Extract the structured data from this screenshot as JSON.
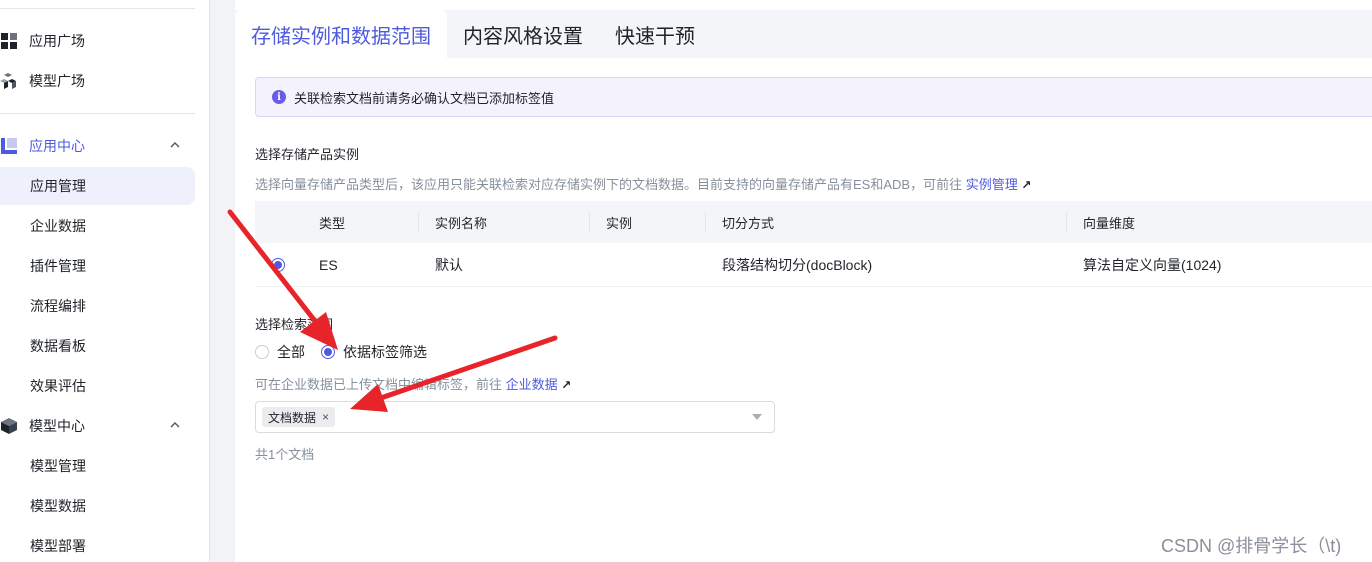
{
  "sidebar": {
    "items": [
      {
        "label": "应用广场",
        "icon": "grid-icon",
        "type": "top"
      },
      {
        "label": "模型广场",
        "icon": "cubes-icon",
        "type": "top"
      },
      {
        "label": "应用中心",
        "icon": "app-center-icon",
        "type": "group",
        "expanded": true
      },
      {
        "label": "应用管理",
        "type": "sub",
        "selected": true
      },
      {
        "label": "企业数据",
        "type": "sub"
      },
      {
        "label": "插件管理",
        "type": "sub"
      },
      {
        "label": "流程编排",
        "type": "sub"
      },
      {
        "label": "数据看板",
        "type": "sub"
      },
      {
        "label": "效果评估",
        "type": "sub"
      },
      {
        "label": "模型中心",
        "icon": "model-center-icon",
        "type": "group",
        "expanded": true
      },
      {
        "label": "模型管理",
        "type": "sub"
      },
      {
        "label": "模型数据",
        "type": "sub"
      },
      {
        "label": "模型部署",
        "type": "sub"
      }
    ]
  },
  "tabs": [
    {
      "label": "存储实例和数据范围",
      "active": true
    },
    {
      "label": "内容风格设置",
      "active": false
    },
    {
      "label": "快速干预",
      "active": false
    }
  ],
  "notice": {
    "text": "关联检索文档前请务必确认文档已添加标签值"
  },
  "storage": {
    "title": "选择存储产品实例",
    "hint": "选择向量存储产品类型后，该应用只能关联检索对应存储实例下的文档数据。目前支持的向量存储产品有ES和ADB，可前往",
    "link": "实例管理",
    "columns": [
      "类型",
      "实例名称",
      "实例",
      "切分方式",
      "向量维度"
    ],
    "rows": [
      {
        "selected": true,
        "cells": [
          "ES",
          "默认",
          "",
          "段落结构切分(docBlock)",
          "算法自定义向量(1024)"
        ]
      }
    ]
  },
  "scope": {
    "title": "选择检索范围",
    "options": [
      {
        "label": "全部",
        "selected": false
      },
      {
        "label": "依据标签筛选",
        "selected": true
      }
    ],
    "hint": "可在企业数据已上传文档中编辑标签，前往",
    "link": "企业数据",
    "tags": [
      "文档数据"
    ],
    "count_text": "共1个文档"
  },
  "watermark": "CSDN @排骨学长（\\t)",
  "colors": {
    "accent": "#4e5bdf",
    "arrow": "#e8242b"
  }
}
